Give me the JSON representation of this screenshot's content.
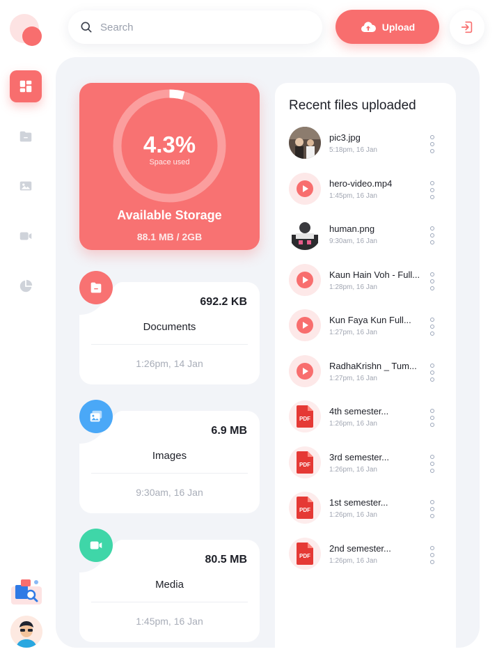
{
  "search": {
    "placeholder": "Search"
  },
  "toolbar": {
    "upload_label": "Upload"
  },
  "storage": {
    "percent": "4.3%",
    "percent_caption": "Space used",
    "percent_value": 4.3,
    "title": "Available Storage",
    "usage": "88.1 MB / 2GB"
  },
  "categories": [
    {
      "name": "Documents",
      "size": "692.2 KB",
      "time": "1:26pm, 14 Jan",
      "color": "#f87272",
      "icon": "document-icon"
    },
    {
      "name": "Images",
      "size": "6.9 MB",
      "time": "9:30am, 16 Jan",
      "color": "#4aa8f7",
      "icon": "image-icon"
    },
    {
      "name": "Media",
      "size": "80.5 MB",
      "time": "1:45pm, 16 Jan",
      "color": "#3fd6a8",
      "icon": "video-icon"
    }
  ],
  "recent": {
    "title": "Recent files uploaded",
    "files": [
      {
        "name": "pic3.jpg",
        "date": "5:18pm, 16 Jan",
        "type": "photo"
      },
      {
        "name": "hero-video.mp4",
        "date": "1:45pm, 16 Jan",
        "type": "video"
      },
      {
        "name": "human.png",
        "date": "9:30am, 16 Jan",
        "type": "photo"
      },
      {
        "name": "Kaun Hain Voh - Full...",
        "date": "1:28pm, 16 Jan",
        "type": "video"
      },
      {
        "name": "Kun Faya Kun Full...",
        "date": "1:27pm, 16 Jan",
        "type": "video"
      },
      {
        "name": "RadhaKrishn _ Tum...",
        "date": "1:27pm, 16 Jan",
        "type": "video"
      },
      {
        "name": "4th semester...",
        "date": "1:26pm, 16 Jan",
        "type": "pdf"
      },
      {
        "name": "3rd semester...",
        "date": "1:26pm, 16 Jan",
        "type": "pdf"
      },
      {
        "name": "1st semester...",
        "date": "1:26pm, 16 Jan",
        "type": "pdf"
      },
      {
        "name": "2nd semester...",
        "date": "1:26pm, 16 Jan",
        "type": "pdf"
      }
    ],
    "pdf_label": "PDF"
  },
  "colors": {
    "accent": "#f86e6e",
    "panel": "#f2f4f8"
  }
}
